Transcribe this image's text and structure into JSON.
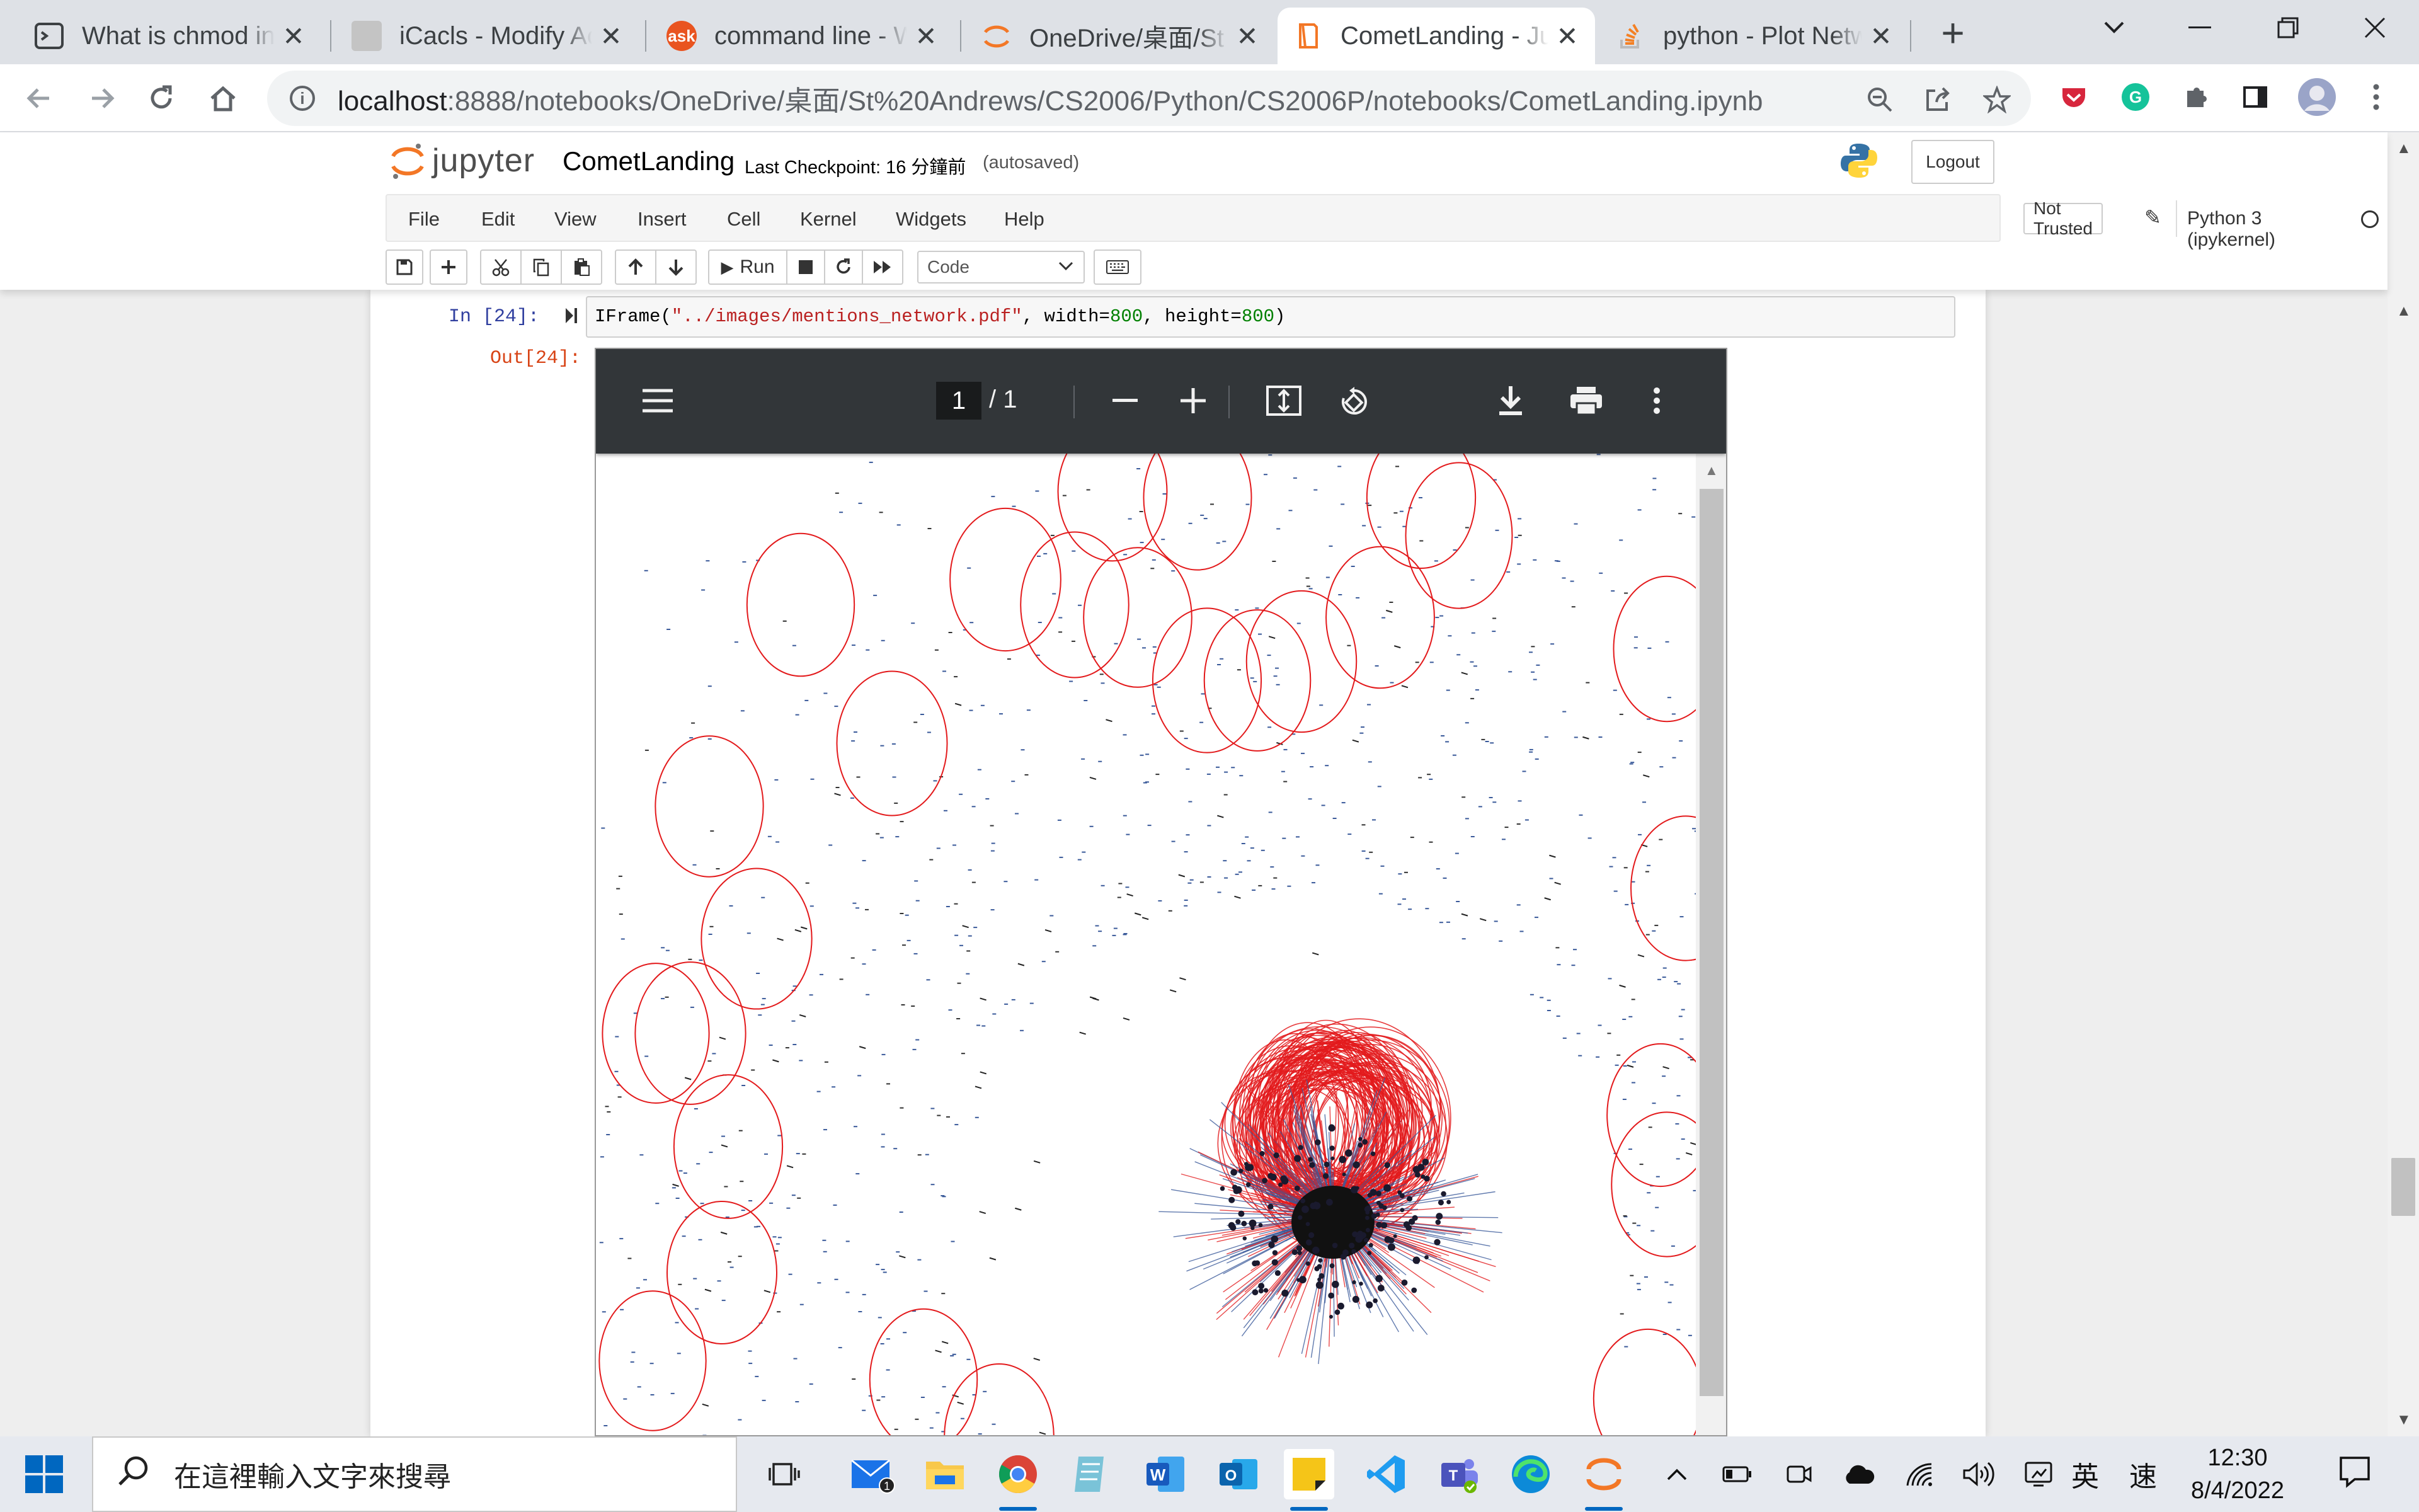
{
  "browser": {
    "tabs": [
      {
        "title": "What is chmod in",
        "icon": "terminal-icon"
      },
      {
        "title": "iCacls - Modify Ac",
        "icon": "generic-page-icon"
      },
      {
        "title": "command line - W",
        "icon": "askubuntu-icon"
      },
      {
        "title": "OneDrive/桌面/St",
        "icon": "jupyter-icon"
      },
      {
        "title": "CometLanding - Ju",
        "icon": "jupyter-notebook-icon"
      },
      {
        "title": "python - Plot Netw",
        "icon": "stackoverflow-icon"
      }
    ],
    "active_tab": 4,
    "url_host": "localhost",
    "url_path": ":8888/notebooks/OneDrive/桌面/St%20Andrews/CS2006/Python/CS2006P/notebooks/CometLanding.ipynb"
  },
  "jupyter": {
    "logo_text": "jupyter",
    "notebook_name": "CometLanding",
    "checkpoint": "Last Checkpoint: 16 分鐘前",
    "autosave": "(autosaved)",
    "logout": "Logout",
    "menu": [
      "File",
      "Edit",
      "View",
      "Insert",
      "Cell",
      "Kernel",
      "Widgets",
      "Help"
    ],
    "trusted": "Not Trusted",
    "kernel": "Python 3 (ipykernel)",
    "run_label": "Run",
    "cell_type": "Code"
  },
  "cell": {
    "in_prompt": "In [24]:",
    "out_prompt": "Out[24]:",
    "code_func": "IFrame(",
    "code_str": "\"../images/mentions_network.pdf\"",
    "code_mid1": ", width=",
    "code_num1": "800",
    "code_mid2": ", height=",
    "code_num2": "800",
    "code_end": ")"
  },
  "pdf": {
    "page_current": "1",
    "page_total": "/ 1"
  },
  "taskbar": {
    "search_placeholder": "在這裡輸入文字來搜尋",
    "mail_badge": "1",
    "ime_lang": "英",
    "ime_mode": "速",
    "time": "12:30",
    "date": "8/4/2022"
  },
  "colors": {
    "accent": "#0067c0",
    "jupyter_orange": "#f37726",
    "network_red": "#e31a1c",
    "node_blue": "#3a5a9a"
  }
}
